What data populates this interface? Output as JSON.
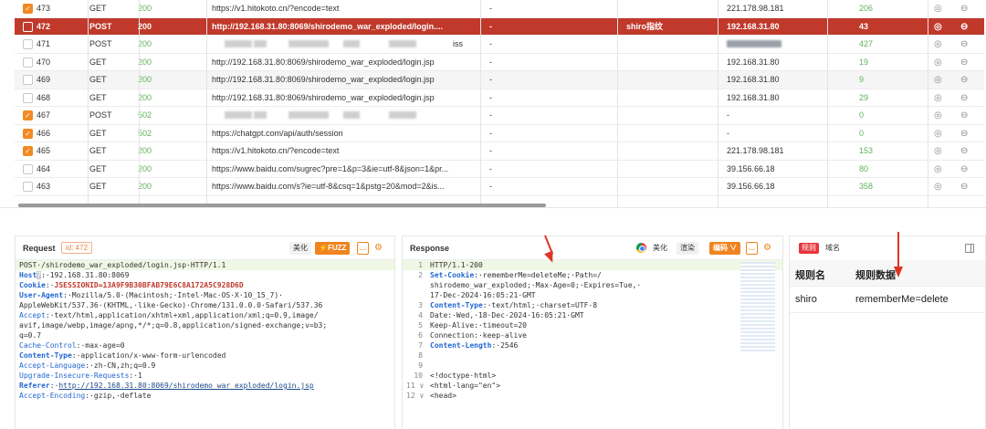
{
  "history": {
    "rows": [
      {
        "checked": true,
        "id": "473",
        "method": "GET",
        "status": "200",
        "url": "https://v1.hitokoto.cn/?encode=text",
        "dash": "-",
        "tag": "",
        "ip": "221.178.98.181",
        "count": "206",
        "selected": false,
        "alt": false
      },
      {
        "checked": false,
        "id": "472",
        "method": "POST",
        "status": "200",
        "url": "http://192.168.31.80:8069/shirodemo_war_exploded/login....",
        "dash": "-",
        "tag": "shiro指纹",
        "ip": "192.168.31.80",
        "count": "43",
        "selected": true,
        "alt": false
      },
      {
        "checked": false,
        "id": "471",
        "method": "POST",
        "status": "200",
        "url": "",
        "dash": "-",
        "tag": "",
        "ip": "",
        "count": "427",
        "selected": false,
        "alt": false,
        "blurred": true,
        "url_tail": "iss"
      },
      {
        "checked": false,
        "id": "470",
        "method": "GET",
        "status": "200",
        "url": "http://192.168.31.80:8069/shirodemo_war_exploded/login.jsp",
        "dash": "-",
        "tag": "",
        "ip": "192.168.31.80",
        "count": "19",
        "selected": false,
        "alt": false
      },
      {
        "checked": false,
        "id": "469",
        "method": "GET",
        "status": "200",
        "url": "http://192.168.31.80:8069/shirodemo_war_exploded/login.jsp",
        "dash": "-",
        "tag": "",
        "ip": "192.168.31.80",
        "count": "9",
        "selected": false,
        "alt": true
      },
      {
        "checked": false,
        "id": "468",
        "method": "GET",
        "status": "200",
        "url": "http://192.168.31.80:8069/shirodemo_war_exploded/login.jsp",
        "dash": "-",
        "tag": "",
        "ip": "192.168.31.80",
        "count": "29",
        "selected": false,
        "alt": false
      },
      {
        "checked": true,
        "id": "467",
        "method": "POST",
        "status": "502",
        "url": "",
        "dash": "-",
        "tag": "",
        "ip": "-",
        "count": "0",
        "selected": false,
        "alt": false,
        "blurred": true,
        "url_tail": ""
      },
      {
        "checked": true,
        "id": "466",
        "method": "GET",
        "status": "502",
        "url": "https://chatgpt.com/api/auth/session",
        "dash": "-",
        "tag": "",
        "ip": "-",
        "count": "0",
        "selected": false,
        "alt": false
      },
      {
        "checked": true,
        "id": "465",
        "method": "GET",
        "status": "200",
        "url": "https://v1.hitokoto.cn/?encode=text",
        "dash": "-",
        "tag": "",
        "ip": "221.178.98.181",
        "count": "153",
        "selected": false,
        "alt": false
      },
      {
        "checked": false,
        "id": "464",
        "method": "GET",
        "status": "200",
        "url": "https://www.baidu.com/sugrec?pre=1&p=3&ie=utf-8&json=1&pr...",
        "dash": "-",
        "tag": "",
        "ip": "39.156.66.18",
        "count": "80",
        "selected": false,
        "alt": false
      },
      {
        "checked": false,
        "id": "463",
        "method": "GET",
        "status": "200",
        "url": "https://www.baidu.com/s?ie=utf-8&csq=1&pstg=20&mod=2&is...",
        "dash": "-",
        "tag": "",
        "ip": "39.156.66.18",
        "count": "358",
        "selected": false,
        "alt": false
      }
    ],
    "action_icons": {
      "a1": "◎",
      "a2": "⊖"
    }
  },
  "request": {
    "title": "Request",
    "id_badge": "id: 472",
    "beautify": "美化",
    "fuzz": "⚡FUZZ",
    "lines": [
      {
        "hl": true,
        "html": "POST·/shirodemo_war_exploded/login.jsp·HTTP/1.1"
      },
      {
        "hl": false,
        "key": "Host",
        "mark": "?",
        "val": ":·192.168.31.80:8069"
      },
      {
        "hl": false,
        "key": "Cookie",
        "val": ":·",
        "cookie": "JSESSIONID=13A9F9B30BFAB79E6C8A172A5C928D6D"
      },
      {
        "hl": false,
        "key": "User-Agent",
        "val": ":·Mozilla/5.0·(Macintosh;·Intel·Mac·OS·X·10_15_7)·"
      },
      {
        "hl": false,
        "plain": "AppleWebKit/537.36·(KHTML,·like·Gecko)·Chrome/131.0.0.0·Safari/537.36"
      },
      {
        "hl": false,
        "keyp": "Accept",
        "val": ":·text/html,application/xhtml+xml,application/xml;q=0.9,image/"
      },
      {
        "hl": false,
        "plain": "avif,image/webp,image/apng,*/*;q=0.8,application/signed-exchange;v=b3;"
      },
      {
        "hl": false,
        "plain": "q=0.7"
      },
      {
        "hl": false,
        "keyp": "Cache-Control",
        "val": ":·max-age=0"
      },
      {
        "hl": false,
        "key": "Content-Type",
        "val": ":·application/x-www-form-urlencoded"
      },
      {
        "hl": false,
        "keyp": "Accept-Language",
        "val": ":·zh-CN,zh;q=0.9"
      },
      {
        "hl": false,
        "keyp": "Upgrade-Insecure-Requests",
        "val": ":·1"
      },
      {
        "hl": false,
        "key": "Referer",
        "val": ":·",
        "link": "http://192.168.31.80:8069/shirodemo_war_exploded/login.jsp"
      },
      {
        "hl": false,
        "keyp": "Accept-Encoding",
        "val": ":·gzip,·deflate"
      }
    ]
  },
  "response": {
    "title": "Response",
    "beautify": "美化",
    "render": "渲染",
    "encoding": "编码 ∨",
    "lines": [
      {
        "n": "1",
        "hl": true,
        "plain": "HTTP/1.1·200"
      },
      {
        "n": "2",
        "hl": false,
        "key": "Set-Cookie",
        "val": ":·rememberMe=deleteMe;·Path=/"
      },
      {
        "n": "",
        "hl": false,
        "plain": "shirodemo_war_exploded;·Max-Age=0;·Expires=Tue,·"
      },
      {
        "n": "",
        "hl": false,
        "plain": "17-Dec-2024·16:05:21·GMT"
      },
      {
        "n": "3",
        "hl": false,
        "key": "Content-Type",
        "val": ":·text/html;·charset=UTF-8"
      },
      {
        "n": "4",
        "hl": false,
        "plain": "Date:·Wed,·18·Dec·2024·16:05:21·GMT"
      },
      {
        "n": "5",
        "hl": false,
        "plain": "Keep-Alive:·timeout=20"
      },
      {
        "n": "6",
        "hl": false,
        "plain": "Connection:·keep-alive"
      },
      {
        "n": "7",
        "hl": false,
        "key": "Content-Length",
        "val": ":·2546"
      },
      {
        "n": "8",
        "hl": false,
        "plain": ""
      },
      {
        "n": "9",
        "hl": false,
        "plain": ""
      },
      {
        "n": "10",
        "hl": false,
        "plain": "<!doctype·html>"
      },
      {
        "n": "11 ∨",
        "hl": false,
        "plain": "<html·lang=\"en\">"
      },
      {
        "n": "12 ∨",
        "hl": false,
        "plain": "<head>"
      }
    ]
  },
  "rules": {
    "tab_active": "规则",
    "tab_inactive": "域名",
    "col_name": "规则名",
    "col_data": "规则数据",
    "row_name": "shiro",
    "row_data": "rememberMe=delete"
  },
  "colors": {
    "selected_row": "#c0392b",
    "accent": "#f0841f",
    "status_green": "#60b05a",
    "arrow": "#e03424"
  }
}
